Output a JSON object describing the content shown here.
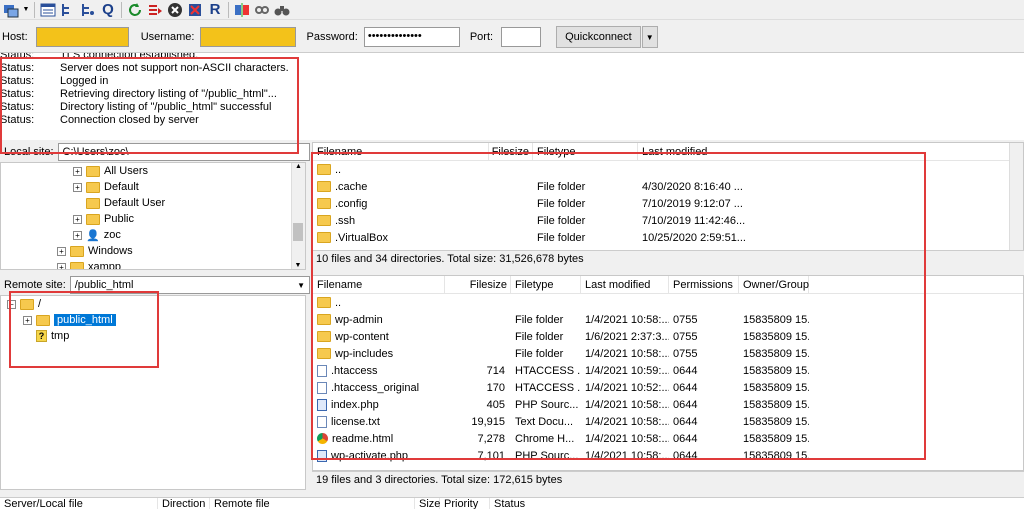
{
  "toolbar": {
    "icons": [
      "site-manager-icon",
      "dropdown-arrow-icon",
      "toggle-log-icon",
      "toggle-local-tree-icon",
      "toggle-remote-tree-icon",
      "toggle-queue-icon",
      "refresh-icon",
      "process-queue-icon",
      "cancel-icon",
      "disconnect-icon",
      "reconnect-icon",
      "compare-icon",
      "sync-browse-icon",
      "find-icon"
    ],
    "queue_letter": "Q",
    "reconnect_letter": "R"
  },
  "quickconnect": {
    "host_label": "Host:",
    "username_label": "Username:",
    "password_label": "Password:",
    "password_value": "••••••••••••••",
    "port_label": "Port:",
    "button_label": "Quickconnect",
    "highlight_color": "#f3c21a"
  },
  "log": [
    {
      "k": "Status:",
      "v": "TLS connection established."
    },
    {
      "k": "Status:",
      "v": "Server does not support non-ASCII characters."
    },
    {
      "k": "Status:",
      "v": "Logged in"
    },
    {
      "k": "Status:",
      "v": "Retrieving directory listing of \"/public_html\"..."
    },
    {
      "k": "Status:",
      "v": "Directory listing of \"/public_html\" successful"
    },
    {
      "k": "Status:",
      "v": "Connection closed by server"
    }
  ],
  "local": {
    "site_label": "Local site:",
    "site_value": "C:\\Users\\zoc\\",
    "tree": [
      "All Users",
      "Default",
      "Default User",
      "Public",
      "zoc",
      "Windows",
      "xampp"
    ],
    "columns": [
      "Filename",
      "Filesize",
      "Filetype",
      "Last modified"
    ],
    "files": [
      {
        "name": "..",
        "size": "",
        "type": "",
        "modified": ""
      },
      {
        "name": ".cache",
        "size": "",
        "type": "File folder",
        "modified": "4/30/2020 8:16:40 ..."
      },
      {
        "name": ".config",
        "size": "",
        "type": "File folder",
        "modified": "7/10/2019 9:12:07 ..."
      },
      {
        "name": ".ssh",
        "size": "",
        "type": "File folder",
        "modified": "7/10/2019 11:42:46..."
      },
      {
        "name": ".VirtualBox",
        "size": "",
        "type": "File folder",
        "modified": "10/25/2020 2:59:51..."
      }
    ],
    "status": "10 files and 34 directories. Total size: 31,526,678 bytes"
  },
  "remote": {
    "site_label": "Remote site:",
    "site_value": "/public_html",
    "tree_root": "/",
    "tree": [
      "public_html",
      "tmp"
    ],
    "columns": [
      "Filename",
      "Filesize",
      "Filetype",
      "Last modified",
      "Permissions",
      "Owner/Group"
    ],
    "files": [
      {
        "icon": "folder",
        "name": "..",
        "size": "",
        "type": "",
        "modified": "",
        "perms": "",
        "owner": ""
      },
      {
        "icon": "folder",
        "name": "wp-admin",
        "size": "",
        "type": "File folder",
        "modified": "1/4/2021 10:58:...",
        "perms": "0755",
        "owner": "15835809 15..."
      },
      {
        "icon": "folder",
        "name": "wp-content",
        "size": "",
        "type": "File folder",
        "modified": "1/6/2021 2:37:3...",
        "perms": "0755",
        "owner": "15835809 15..."
      },
      {
        "icon": "folder",
        "name": "wp-includes",
        "size": "",
        "type": "File folder",
        "modified": "1/4/2021 10:58:...",
        "perms": "0755",
        "owner": "15835809 15..."
      },
      {
        "icon": "file",
        "name": ".htaccess",
        "size": "714",
        "type": "HTACCESS ...",
        "modified": "1/4/2021 10:59:...",
        "perms": "0644",
        "owner": "15835809 15..."
      },
      {
        "icon": "file",
        "name": ".htaccess_original",
        "size": "170",
        "type": "HTACCESS ...",
        "modified": "1/4/2021 10:52:...",
        "perms": "0644",
        "owner": "15835809 15..."
      },
      {
        "icon": "web",
        "name": "index.php",
        "size": "405",
        "type": "PHP Sourc...",
        "modified": "1/4/2021 10:58:...",
        "perms": "0644",
        "owner": "15835809 15..."
      },
      {
        "icon": "file",
        "name": "license.txt",
        "size": "19,915",
        "type": "Text Docu...",
        "modified": "1/4/2021 10:58:...",
        "perms": "0644",
        "owner": "15835809 15..."
      },
      {
        "icon": "chrome",
        "name": "readme.html",
        "size": "7,278",
        "type": "Chrome H...",
        "modified": "1/4/2021 10:58:...",
        "perms": "0644",
        "owner": "15835809 15..."
      },
      {
        "icon": "web",
        "name": "wp-activate.php",
        "size": "7,101",
        "type": "PHP Sourc...",
        "modified": "1/4/2021 10:58:...",
        "perms": "0644",
        "owner": "15835809 15..."
      }
    ],
    "status": "19 files and 3 directories. Total size: 172,615 bytes"
  },
  "queue": {
    "columns": [
      "Server/Local file",
      "Direction",
      "Remote file",
      "Size",
      "Priority",
      "Status"
    ]
  },
  "accent": "#e03a3a"
}
